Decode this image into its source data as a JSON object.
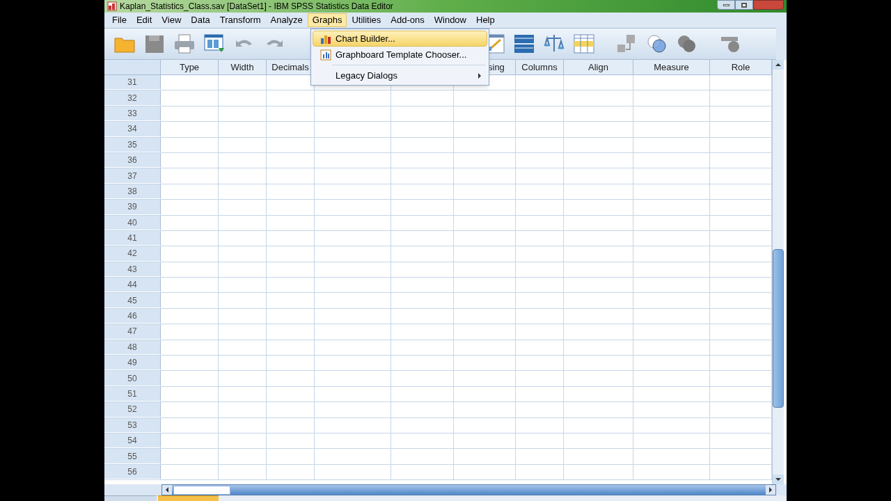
{
  "window": {
    "title": "Kaplan_Statistics_Class.sav [DataSet1] - IBM SPSS Statistics Data Editor"
  },
  "menu": [
    {
      "label": "File",
      "selected": false
    },
    {
      "label": "Edit",
      "selected": false
    },
    {
      "label": "View",
      "selected": false
    },
    {
      "label": "Data",
      "selected": false
    },
    {
      "label": "Transform",
      "selected": false
    },
    {
      "label": "Analyze",
      "selected": false
    },
    {
      "label": "Graphs",
      "selected": true
    },
    {
      "label": "Utilities",
      "selected": false
    },
    {
      "label": "Add-ons",
      "selected": false
    },
    {
      "label": "Window",
      "selected": false
    },
    {
      "label": "Help",
      "selected": false
    }
  ],
  "dropdown": [
    {
      "label": "Chart Builder...",
      "selected": true,
      "kind": "chart"
    },
    {
      "label": "Graphboard Template Chooser...",
      "selected": false,
      "kind": "graphboard"
    },
    {
      "label": "Legacy Dialogs",
      "selected": false,
      "kind": "submenu"
    }
  ],
  "columns": [
    {
      "label": "Type"
    },
    {
      "label": "Width"
    },
    {
      "label": "Decimals"
    },
    {},
    {},
    {
      "label": "sing"
    },
    {
      "label": "Columns"
    },
    {
      "label": "Align"
    },
    {
      "label": "Measure"
    },
    {
      "label": "Role"
    }
  ],
  "rows": [
    "31",
    "32",
    "33",
    "34",
    "35",
    "36",
    "37",
    "38",
    "39",
    "40",
    "41",
    "42",
    "43",
    "44",
    "45",
    "46",
    "47",
    "48",
    "49",
    "50",
    "51",
    "52",
    "53",
    "54",
    "55",
    "56"
  ]
}
